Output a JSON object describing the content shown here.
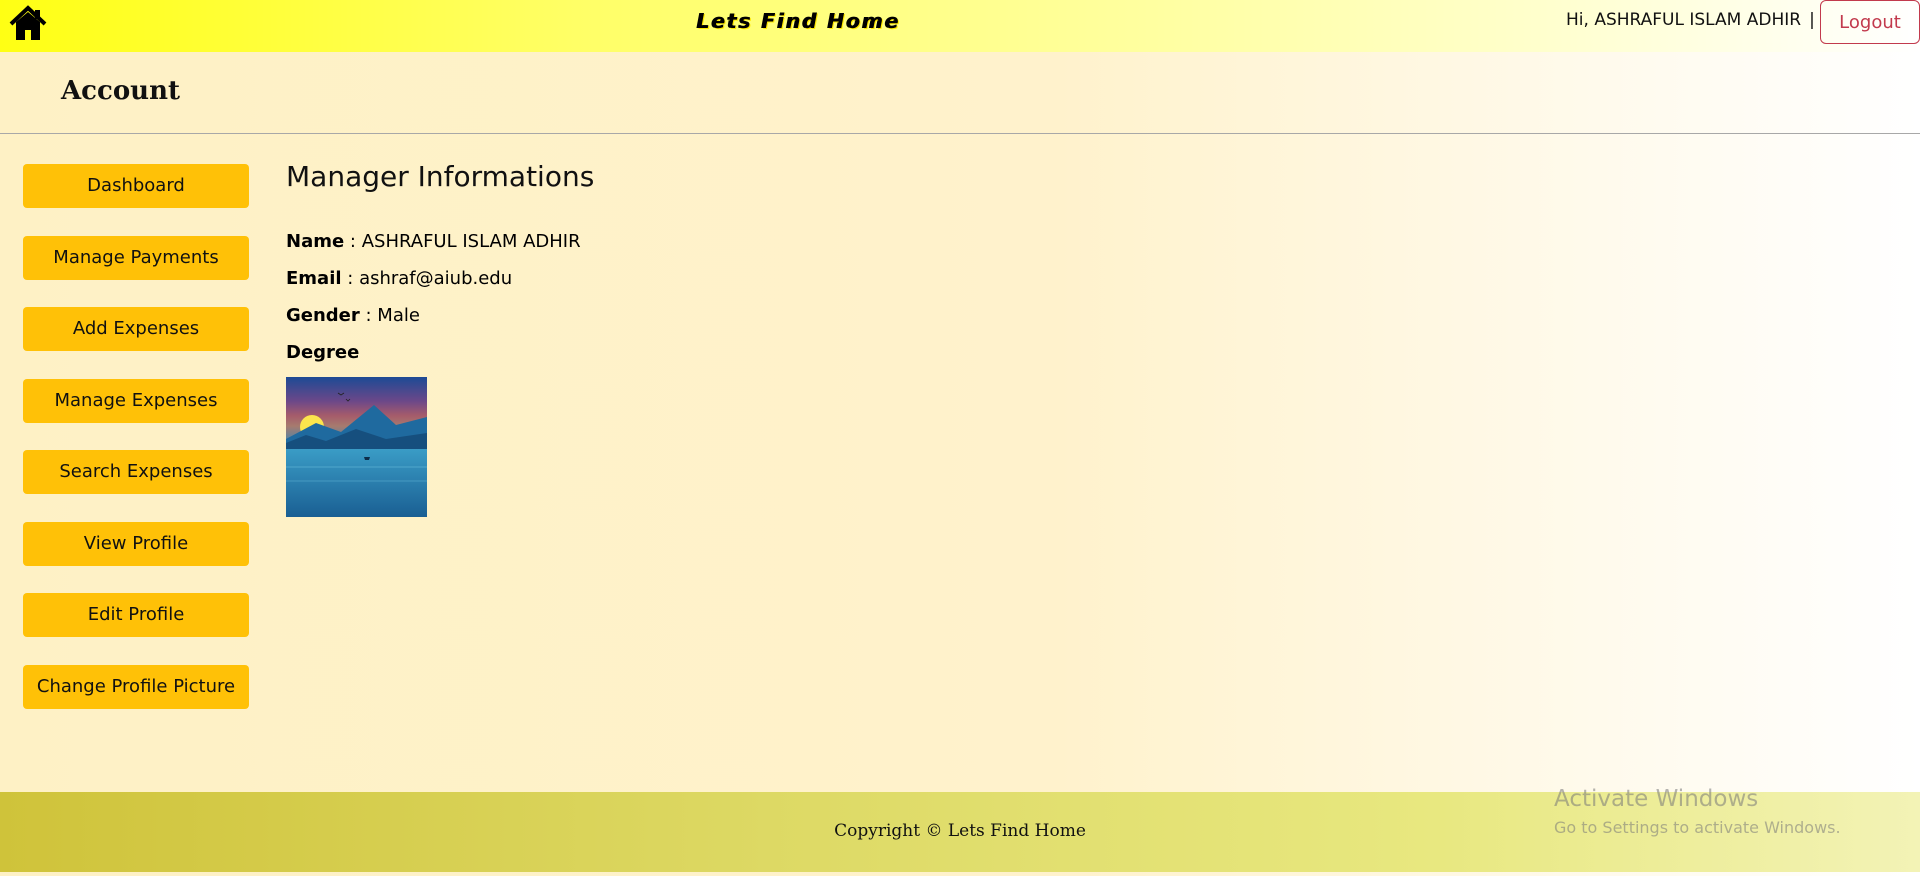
{
  "navbar": {
    "home_icon": "home-icon",
    "brand": "Lets Find Home",
    "greeting": "Hi, ASHRAFUL ISLAM ADHIR",
    "separator": "|",
    "logout_label": "Logout"
  },
  "account": {
    "title": "Account"
  },
  "sidebar": {
    "items": [
      {
        "label": "Dashboard"
      },
      {
        "label": "Manage Payments"
      },
      {
        "label": "Add Expenses"
      },
      {
        "label": "Manage Expenses"
      },
      {
        "label": "Search Expenses"
      },
      {
        "label": "View Profile"
      },
      {
        "label": "Edit Profile"
      },
      {
        "label": "Change Profile Picture"
      }
    ]
  },
  "main": {
    "title": "Manager Informations",
    "fields": [
      {
        "label": "Name",
        "separator": " : ",
        "value": "ASHRAFUL ISLAM ADHIR"
      },
      {
        "label": "Email",
        "separator": " : ",
        "value": "ashraf@aiub.edu"
      },
      {
        "label": "Gender",
        "separator": " : ",
        "value": "Male"
      }
    ],
    "degree_label": "Degree",
    "degree_image": "landscape-sunset-image"
  },
  "footer": {
    "copyright": "Copyright © Lets Find Home"
  },
  "watermark": {
    "title": "Activate Windows",
    "subtitle": "Go to Settings to activate Windows."
  },
  "colors": {
    "nav_button": "#ffc107",
    "logout": "#c23a4d"
  }
}
